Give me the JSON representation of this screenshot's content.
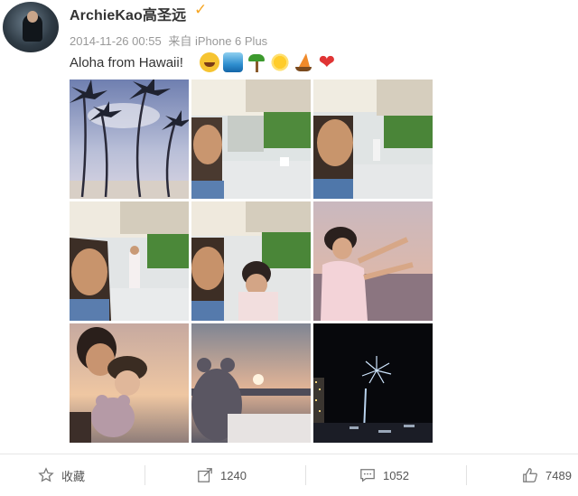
{
  "post": {
    "username": "ArchieKao高圣远",
    "verified_icon": "verified-badge-icon",
    "timestamp": "2014-11-26 00:55",
    "source_prefix": "来自",
    "source_device": "iPhone 6 Plus",
    "text": "Aloha from Hawaii!",
    "emojis": [
      "smile-emoji",
      "surfer-emoji",
      "palm-tree-emoji",
      "sun-emoji",
      "sailboat-emoji",
      "red-heart-emoji"
    ]
  },
  "photos": [
    {
      "name": "photo-palm-trees-beach"
    },
    {
      "name": "photo-selfie-balcony-1"
    },
    {
      "name": "photo-selfie-balcony-2"
    },
    {
      "name": "photo-selfie-woman-waving"
    },
    {
      "name": "photo-selfie-couple-balcony"
    },
    {
      "name": "photo-woman-sunset-pose"
    },
    {
      "name": "photo-couple-sunset-teddy"
    },
    {
      "name": "photo-teddy-bear-sunset"
    },
    {
      "name": "photo-night-fireworks"
    }
  ],
  "actions": {
    "favorite_label": "收藏",
    "share_count": "1240",
    "comment_count": "1052",
    "like_count": "7489"
  },
  "colors": {
    "verified": "#f6a623",
    "meta_text": "#999999",
    "text": "#333333"
  }
}
